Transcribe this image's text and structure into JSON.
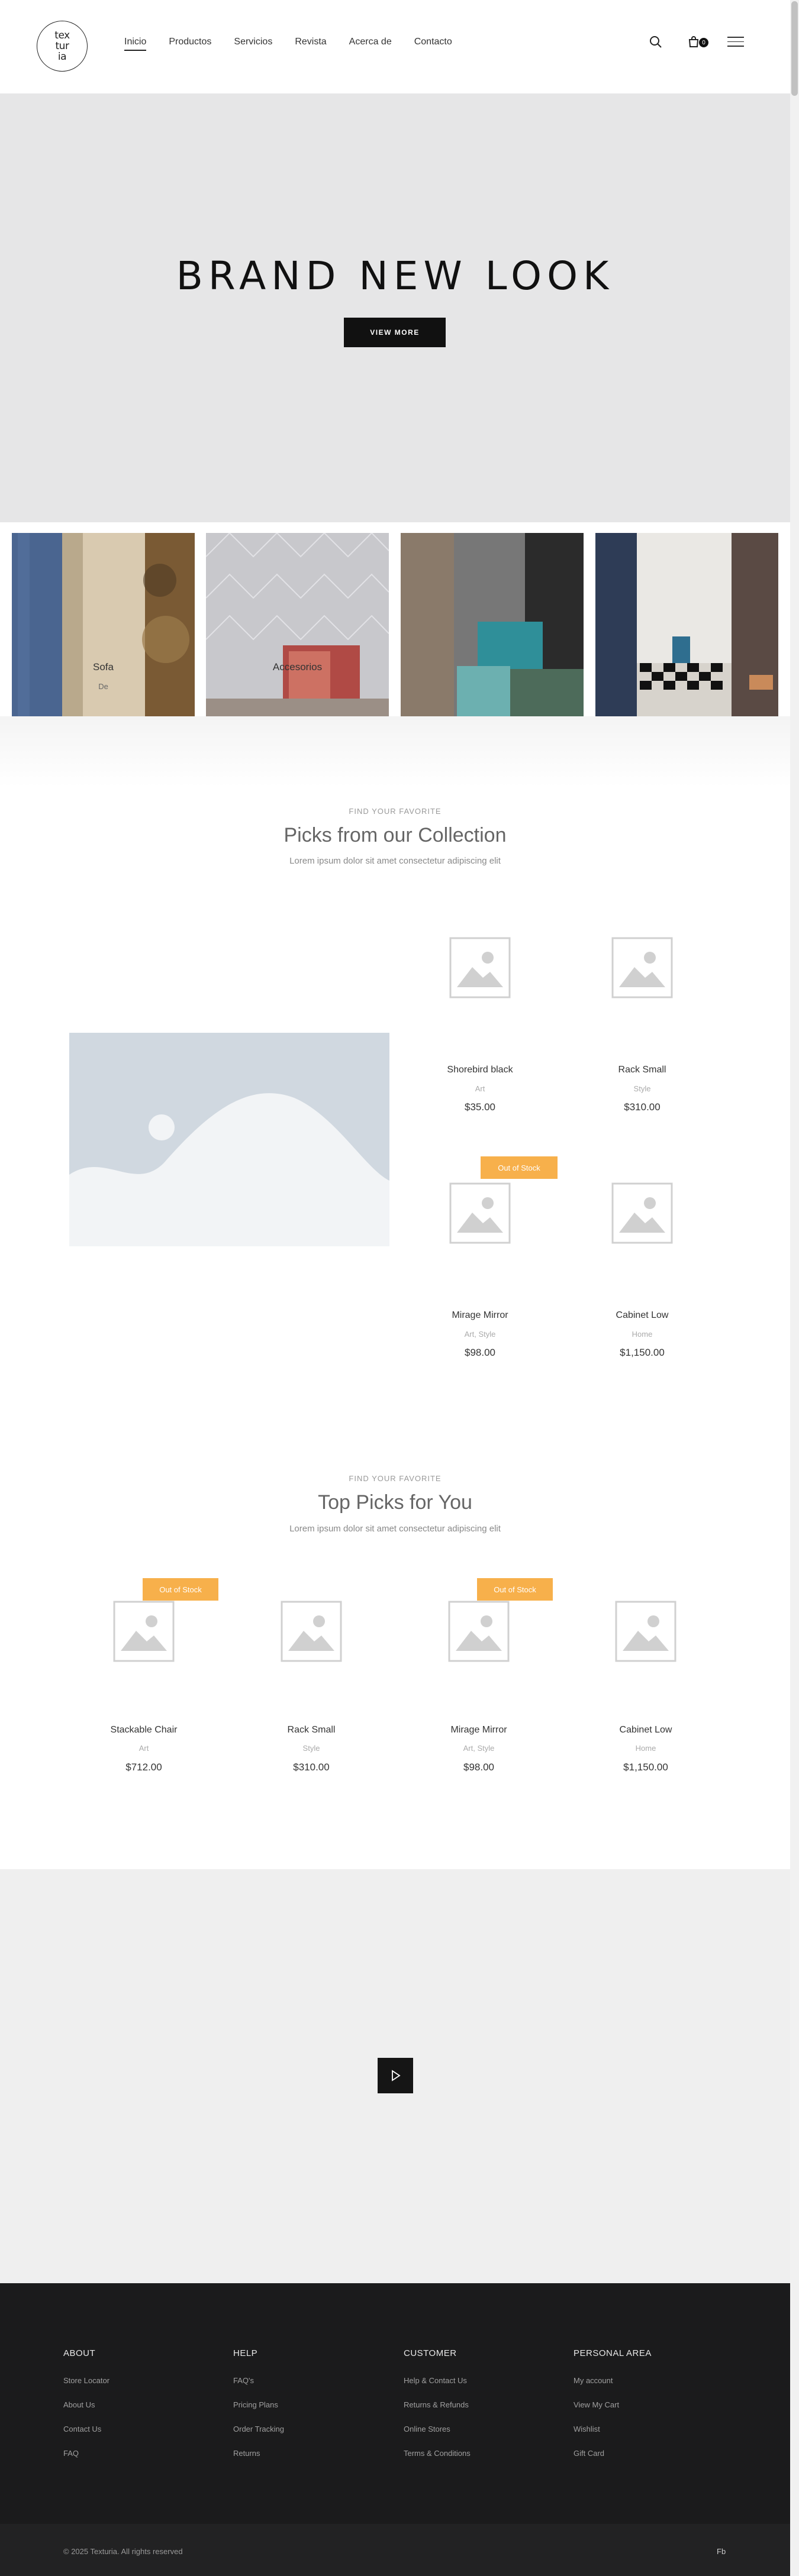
{
  "header": {
    "logo_text": "tex\ntur\nia",
    "nav": [
      "Inicio",
      "Productos",
      "Servicios",
      "Revista",
      "Acerca de",
      "Contacto"
    ],
    "cart_count": "0"
  },
  "hero": {
    "title": "BRAND NEW LOOK",
    "button": "VIEW MORE"
  },
  "categories": [
    {
      "label": "Sofa",
      "sub": "De"
    },
    {
      "label": "Accesorios",
      "sub": ""
    },
    {
      "label": "",
      "sub": ""
    },
    {
      "label": "",
      "sub": ""
    }
  ],
  "section1": {
    "kicker": "FIND YOUR FAVORITE",
    "title": "Picks from our Collection",
    "desc": "Lorem ipsum dolor sit amet consectetur adipiscing elit",
    "products": [
      {
        "name": "Shorebird black",
        "category": "Art",
        "price": "$35.00",
        "badge": ""
      },
      {
        "name": "Rack Small",
        "category": "Style",
        "price": "$310.00",
        "badge": ""
      },
      {
        "name": "Mirage Mirror",
        "category": "Art, Style",
        "price": "$98.00",
        "badge": "Out of Stock"
      },
      {
        "name": "Cabinet Low",
        "category": "Home",
        "price": "$1,150.00",
        "badge": ""
      }
    ]
  },
  "section2": {
    "kicker": "FIND YOUR FAVORITE",
    "title": "Top Picks for You",
    "desc": "Lorem ipsum dolor sit amet consectetur adipiscing elit",
    "products": [
      {
        "name": "Stackable Chair",
        "category": "Art",
        "price": "$712.00",
        "badge": "Out of Stock"
      },
      {
        "name": "Rack Small",
        "category": "Style",
        "price": "$310.00",
        "badge": ""
      },
      {
        "name": "Mirage Mirror",
        "category": "Art, Style",
        "price": "$98.00",
        "badge": "Out of Stock"
      },
      {
        "name": "Cabinet Low",
        "category": "Home",
        "price": "$1,150.00",
        "badge": ""
      }
    ]
  },
  "footer": {
    "columns": [
      {
        "title": "ABOUT",
        "links": [
          "Store Locator",
          "About Us",
          "Contact Us",
          "FAQ"
        ]
      },
      {
        "title": "HELP",
        "links": [
          "FAQ's",
          "Pricing Plans",
          "Order Tracking",
          "Returns"
        ]
      },
      {
        "title": "CUSTOMER",
        "links": [
          "Help & Contact Us",
          "Returns & Refunds",
          "Online Stores",
          "Terms & Conditions"
        ]
      },
      {
        "title": "PERSONAL AREA",
        "links": [
          "My account",
          "View My Cart",
          "Wishlist",
          "Gift Card"
        ]
      }
    ],
    "copyright": "© 2025 Texturia. All rights reserved",
    "social": "Fb"
  },
  "colors": {
    "badge": "#f7b04b",
    "dark": "#1b1b1c",
    "hero_bg": "#e6e6e7"
  }
}
